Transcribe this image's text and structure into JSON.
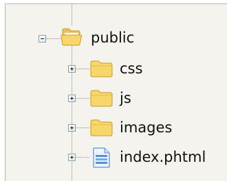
{
  "tree": {
    "root": {
      "label": "public",
      "expanded": true,
      "icon": "folder-open-icon",
      "children": [
        {
          "label": "css",
          "icon": "folder-icon",
          "expanded": false
        },
        {
          "label": "js",
          "icon": "folder-icon",
          "expanded": false
        },
        {
          "label": "images",
          "icon": "folder-icon",
          "expanded": false
        },
        {
          "label": "index.phtml",
          "icon": "file-icon",
          "expanded": false
        }
      ]
    }
  },
  "colors": {
    "panel_background": "#f4f3ee",
    "folder_yellow": "#f7d66a",
    "file_blue": "#5a8fd6",
    "connector": "#8a8a8a"
  }
}
